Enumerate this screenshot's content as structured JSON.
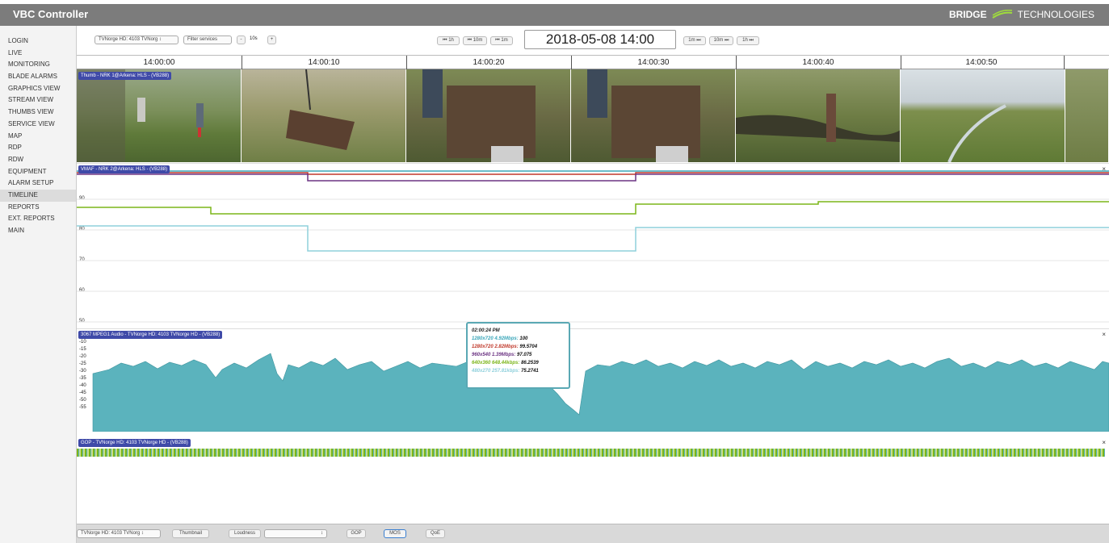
{
  "app": {
    "title": "VBC Controller",
    "brand_bold": "BRIDGE",
    "brand_light": "TECHNOLOGIES"
  },
  "sidebar": {
    "items": [
      {
        "label": "LOGIN"
      },
      {
        "label": "LIVE"
      },
      {
        "label": "MONITORING"
      },
      {
        "label": "BLADE ALARMS"
      },
      {
        "label": "GRAPHICS VIEW"
      },
      {
        "label": "STREAM VIEW"
      },
      {
        "label": "THUMBS VIEW"
      },
      {
        "label": "SERVICE VIEW"
      },
      {
        "label": "MAP"
      },
      {
        "label": "RDP"
      },
      {
        "label": "RDW"
      },
      {
        "label": "EQUIPMENT"
      },
      {
        "label": "ALARM SETUP"
      },
      {
        "label": "TIMELINE",
        "active": true
      },
      {
        "label": "REPORTS"
      },
      {
        "label": "EXT. REPORTS"
      },
      {
        "label": "MAIN"
      }
    ]
  },
  "controls": {
    "service_select": "TVNorge HD: 4103 TVNorg ↕",
    "filter_placeholder": "Filter services",
    "minus": "-",
    "zoom": "10s",
    "plus": "+",
    "nav_back": [
      "⏮ 1h",
      "⏮ 10m",
      "⏮ 1m"
    ],
    "datetime": "2018-05-08 14:00",
    "nav_fwd": [
      "1m ⏭",
      "10m ⏭",
      "1h ⏭"
    ]
  },
  "ruler": {
    "ticks": [
      "14:00:00",
      "14:00:10",
      "14:00:20",
      "14:00:30",
      "14:00:40",
      "14:00:50"
    ]
  },
  "tracks": {
    "thumb_label": "Thumb - NRK 1@Arkena: HLS - (VB288)",
    "vmaf_label": "VMAF - NRK 2@Arkena: HLS - (VB288)",
    "audio_label": "3067 MPEG1 Audio - TVNorge HD: 4103 TVNorge HD - (VB288)",
    "gop_label": "GOP - TVNorge HD: 4103 TVNorge HD - (VB288)",
    "close": "×",
    "vmaf_ticks": [
      "90",
      "80",
      "70",
      "60",
      "50"
    ],
    "audio_ticks": [
      "-10",
      "-15",
      "-20",
      "-25",
      "-30",
      "-35",
      "-40",
      "-45",
      "-50",
      "-55"
    ]
  },
  "tooltip": {
    "time": "02:00:24 PM",
    "rows": [
      {
        "label": "1280x720 4.92Mbps:",
        "value": "100",
        "color": "#3aa6b9"
      },
      {
        "label": "1280x720 2.82Mbps:",
        "value": "99.5704",
        "color": "#c0392b"
      },
      {
        "label": "960x540 1.39Mbps:",
        "value": "97.075",
        "color": "#6c3483"
      },
      {
        "label": "640x360 648.44kbps:",
        "value": "86.2539",
        "color": "#7cb518"
      },
      {
        "label": "480x270 257.81kbps:",
        "value": "75.2741",
        "color": "#8fd0dc"
      }
    ]
  },
  "bottom": {
    "service_select": "TVNorge HD: 4103 TVNorg ↕",
    "thumbnail": "Thumbnail",
    "loudness": "Loudness",
    "loudness_select": "↕",
    "gop": "GOP",
    "mos": "MOS",
    "qoe": "QoE"
  },
  "colors": {
    "accent": "#3f4aa8",
    "audio_fill": "#5bb3bd",
    "topbar": "#7c7c7c"
  }
}
